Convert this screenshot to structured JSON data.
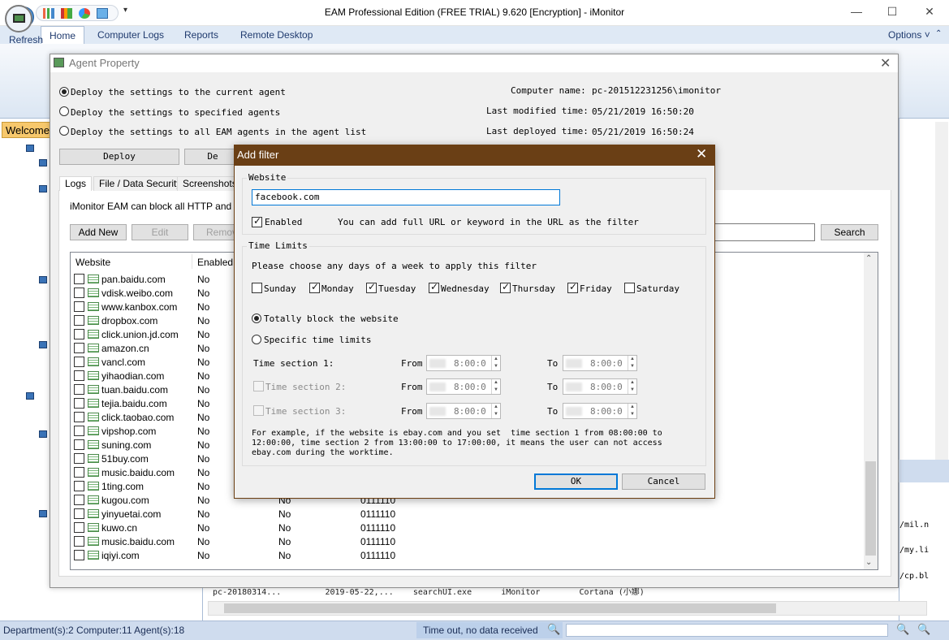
{
  "window": {
    "title": "EAM Professional Edition (FREE TRIAL) 9.620 [Encryption] - iMonitor",
    "qat_more": "▾",
    "minimize": "—",
    "maximize": "☐",
    "close": "✕"
  },
  "ribbon": {
    "tabs": [
      "Home",
      "Computer Logs",
      "Reports",
      "Remote Desktop"
    ],
    "options_label": "Options ˅",
    "refresh_label": "Refresh"
  },
  "left_pane": {
    "welcome_tab": "Welcome"
  },
  "right_pane": {
    "snippets": [
      "/mil.n",
      "/my.li",
      "/cp.bl"
    ]
  },
  "bottom_row": "pc-20180314...         2019-05-22,...    searchUI.exe      iMonitor        Cortana (小娜)",
  "status": {
    "left": "Department(s):2  Computer:11  Agent(s):18",
    "mid": "Time out, no data received"
  },
  "agent_property": {
    "title": "Agent Property",
    "deploy_options": [
      "Deploy the settings to the current agent",
      "Deploy the settings to specified agents",
      "Deploy the settings to all EAM agents in the agent list"
    ],
    "info": [
      {
        "label": "Computer name:",
        "value": "pc-201512231256\\imonitor"
      },
      {
        "label": "Last modified time:",
        "value": "05/21/2019 16:50:20"
      },
      {
        "label": "Last deployed time:",
        "value": "05/21/2019 16:50:24"
      }
    ],
    "deploy_button": "Deploy",
    "deploy2_button": "De",
    "tabs": [
      "Logs",
      "File / Data Security",
      "Screenshots"
    ],
    "description": "iMonitor EAM can block all HTTP and HTT",
    "add_new": "Add New",
    "edit": "Edit",
    "remove": "Remov",
    "search": "Search",
    "columns": {
      "website": "Website",
      "enabled": "Enabled"
    },
    "rows": [
      {
        "site": "pan.baidu.com",
        "enabled": "No",
        "c3": "",
        "c4": ""
      },
      {
        "site": "vdisk.weibo.com",
        "enabled": "No",
        "c3": "",
        "c4": ""
      },
      {
        "site": "www.kanbox.com",
        "enabled": "No",
        "c3": "",
        "c4": ""
      },
      {
        "site": "dropbox.com",
        "enabled": "No",
        "c3": "",
        "c4": ""
      },
      {
        "site": "click.union.jd.com",
        "enabled": "No",
        "c3": "",
        "c4": ""
      },
      {
        "site": "amazon.cn",
        "enabled": "No",
        "c3": "",
        "c4": ""
      },
      {
        "site": "vancl.com",
        "enabled": "No",
        "c3": "",
        "c4": ""
      },
      {
        "site": "yihaodian.com",
        "enabled": "No",
        "c3": "",
        "c4": ""
      },
      {
        "site": "tuan.baidu.com",
        "enabled": "No",
        "c3": "",
        "c4": ""
      },
      {
        "site": "tejia.baidu.com",
        "enabled": "No",
        "c3": "",
        "c4": ""
      },
      {
        "site": "click.taobao.com",
        "enabled": "No",
        "c3": "",
        "c4": ""
      },
      {
        "site": "vipshop.com",
        "enabled": "No",
        "c3": "",
        "c4": ""
      },
      {
        "site": "suning.com",
        "enabled": "No",
        "c3": "",
        "c4": ""
      },
      {
        "site": "51buy.com",
        "enabled": "No",
        "c3": "",
        "c4": ""
      },
      {
        "site": "music.baidu.com",
        "enabled": "No",
        "c3": "",
        "c4": ""
      },
      {
        "site": "1ting.com",
        "enabled": "No",
        "c3": "",
        "c4": ""
      },
      {
        "site": "kugou.com",
        "enabled": "No",
        "c3": "No",
        "c4": "0111110"
      },
      {
        "site": "yinyuetai.com",
        "enabled": "No",
        "c3": "No",
        "c4": "0111110"
      },
      {
        "site": "kuwo.cn",
        "enabled": "No",
        "c3": "No",
        "c4": "0111110"
      },
      {
        "site": "music.baidu.com",
        "enabled": "No",
        "c3": "No",
        "c4": "0111110"
      },
      {
        "site": "iqiyi.com",
        "enabled": "No",
        "c3": "No",
        "c4": "0111110"
      }
    ]
  },
  "add_filter": {
    "title": "Add filter",
    "close": "✕",
    "website_legend": "Website",
    "website_value": "facebook.com",
    "enabled_label": "Enabled",
    "hint": "You can add full URL or keyword in the URL as the filter",
    "time_legend": "Time Limits",
    "choose_days": "Please choose any days of a week to apply this filter",
    "days": [
      {
        "label": "Sunday",
        "checked": false
      },
      {
        "label": "Monday",
        "checked": true
      },
      {
        "label": "Tuesday",
        "checked": true
      },
      {
        "label": "Wednesday",
        "checked": true
      },
      {
        "label": "Thursday",
        "checked": true
      },
      {
        "label": "Friday",
        "checked": true
      },
      {
        "label": "Saturday",
        "checked": false
      }
    ],
    "block_option": "Totally block the website",
    "specific_option": "Specific time limits",
    "sections": [
      {
        "label": "Time section 1:",
        "from_label": "From",
        "from": "8:00:0",
        "to_label": "To",
        "to": "8:00:0"
      },
      {
        "label": "Time section 2:",
        "from_label": "From",
        "from": "8:00:0",
        "to_label": "To",
        "to": "8:00:0"
      },
      {
        "label": "Time section 3:",
        "from_label": "From",
        "from": "8:00:0",
        "to_label": "To",
        "to": "8:00:0"
      }
    ],
    "note": "For example, if the website is ebay.com and you set  time section 1 from 08:00:00 to\n12:00:00, time section 2 from 13:00:00 to 17:00:00, it means the user can not access\nebay.com during the worktime.",
    "ok": "OK",
    "cancel": "Cancel"
  }
}
